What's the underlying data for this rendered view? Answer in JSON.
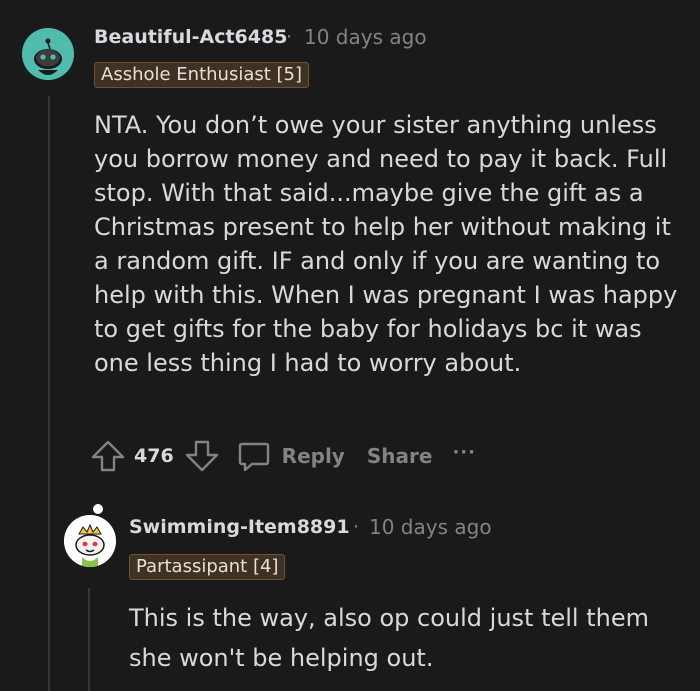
{
  "comments": [
    {
      "username": "Beautiful-Act6485",
      "separator": "·",
      "time": "10 days ago",
      "flair": "Asshole Enthusiast [5]",
      "body": "NTA. You don’t owe your sister anything unless you borrow money and need to pay it back. Full stop. With that said...maybe give the gift as a Christmas present to help her without making it a random gift. IF and only if you are wanting to help with this. When I was pregnant I was happy to get gifts for the baby for holidays bc it was one less thing I had to worry about.",
      "votes": "476",
      "reply_label": "Reply",
      "share_label": "Share",
      "more_label": "···",
      "avatar_icon": "snoo-avatar-icon",
      "accent": "#4fbcae"
    },
    {
      "username": "Swimming-Item8891",
      "separator": "·",
      "time": "10 days ago",
      "flair": "Partassipant [4]",
      "body": "This is the way, also op could just tell them she won't be helping out.",
      "avatar_icon": "snoo-avatar-icon",
      "accent": "#8bc34a"
    }
  ],
  "colors": {
    "background": "#1a1a1b",
    "text": "#d7dadc",
    "muted": "#818384",
    "flair_bg": "#3f3225"
  }
}
